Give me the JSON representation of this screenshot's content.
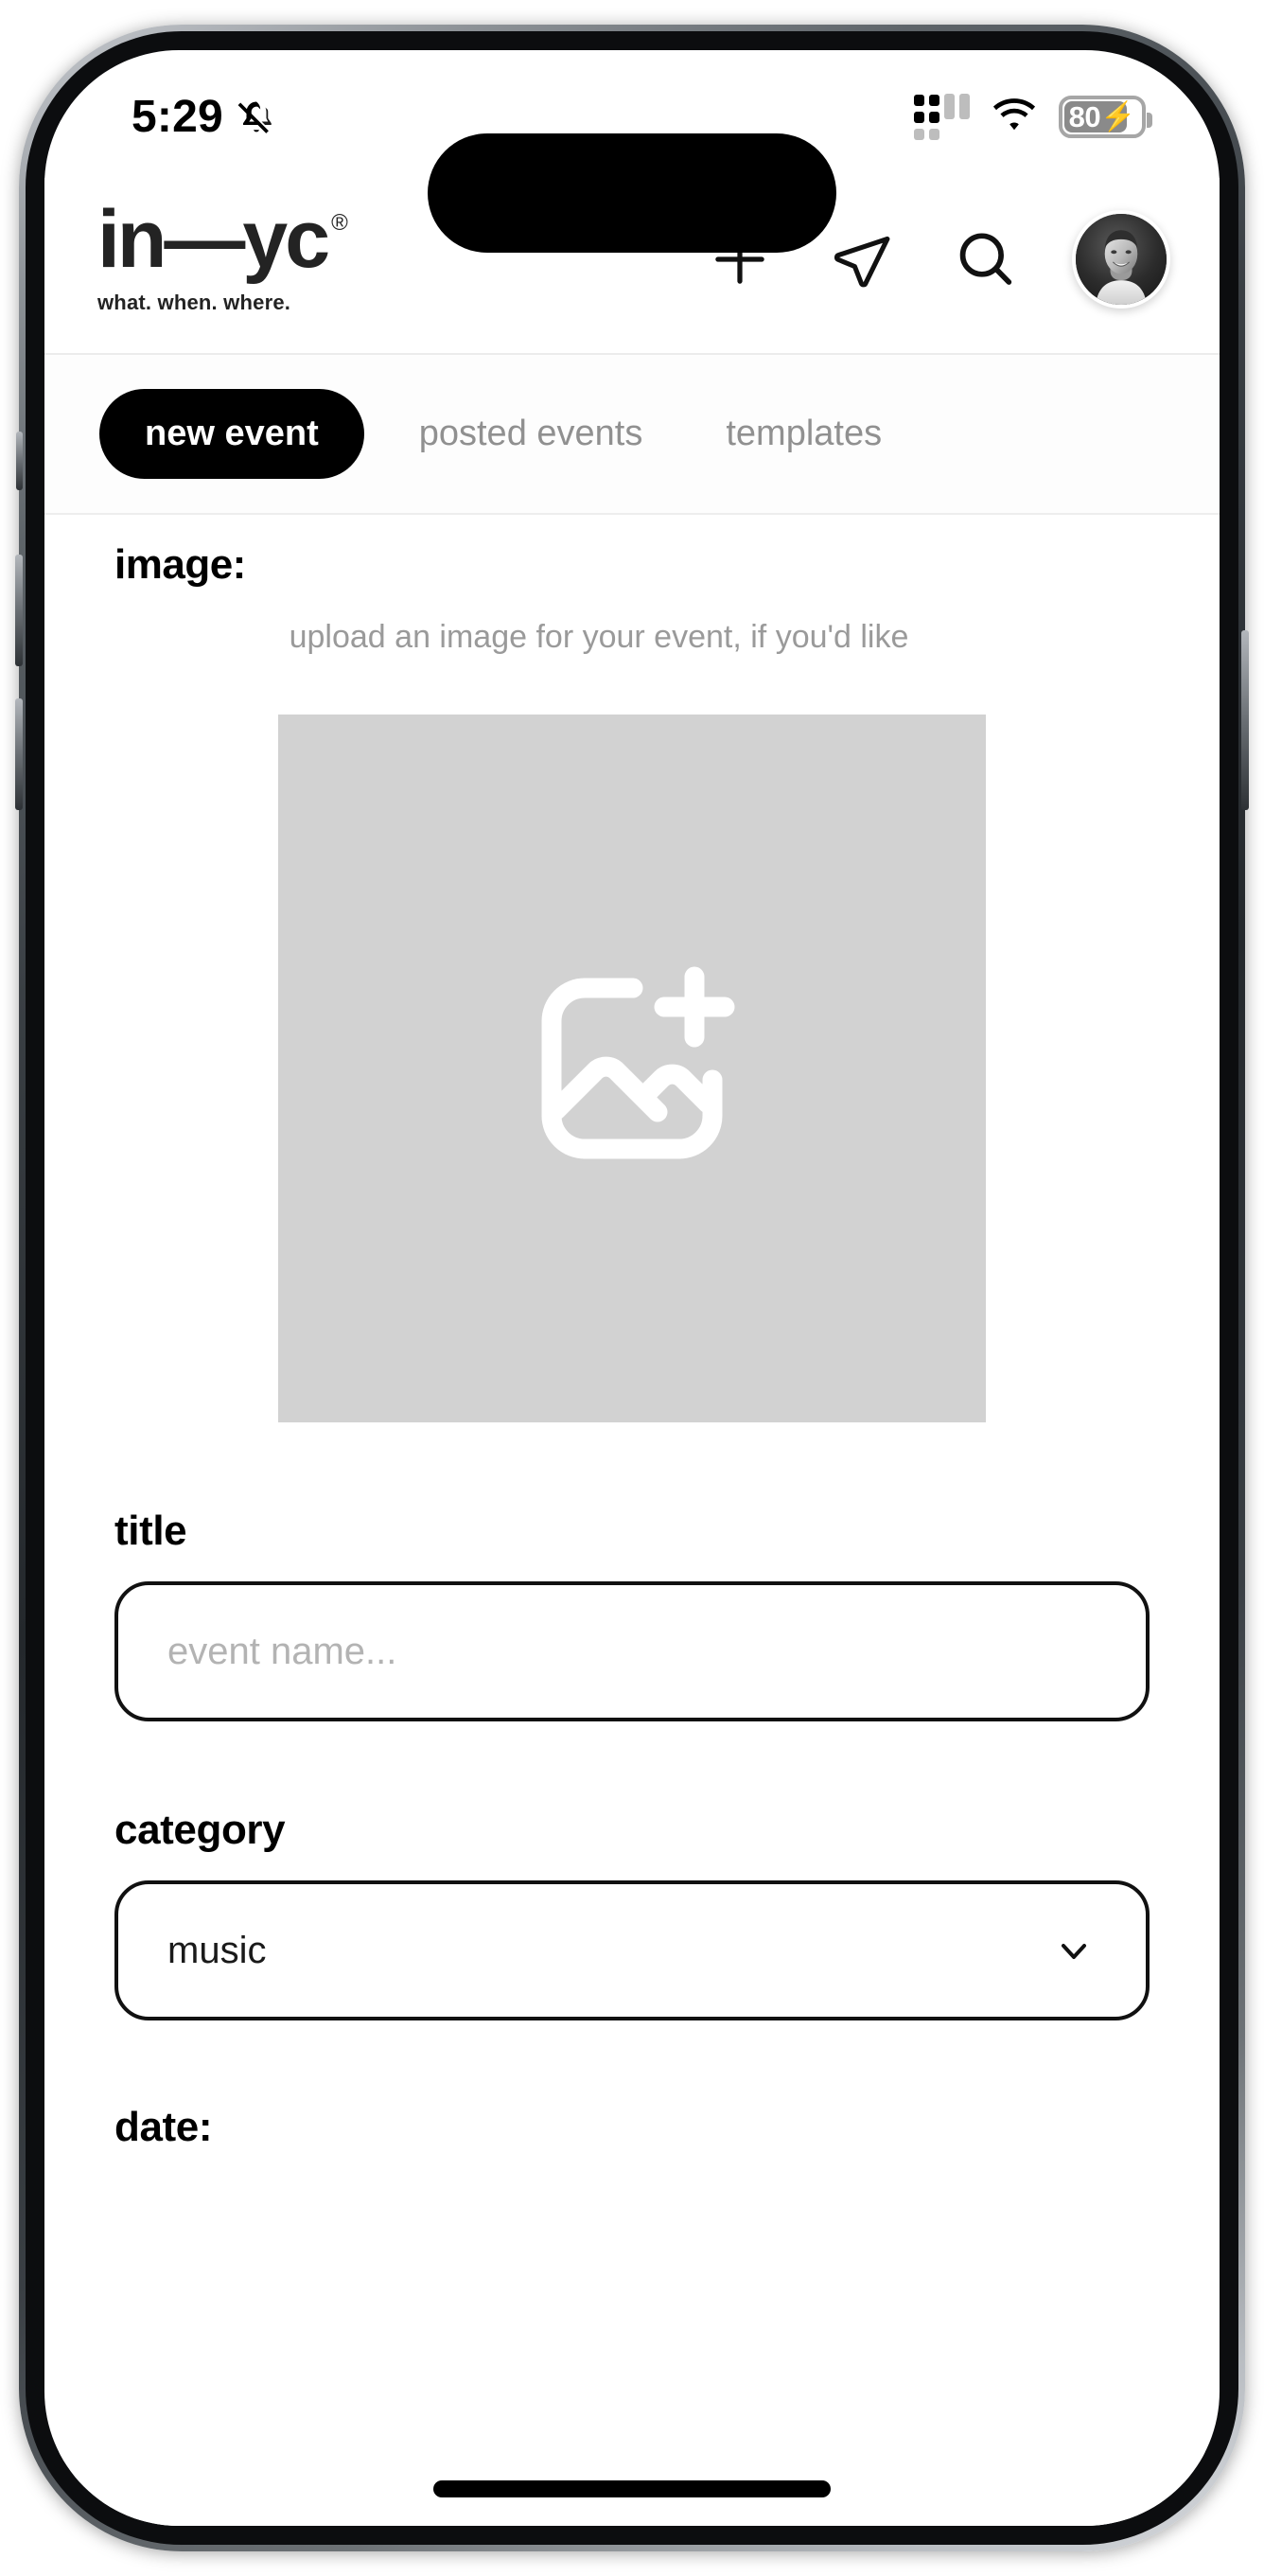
{
  "status_bar": {
    "time": "5:29",
    "bell_icon": "bell-muted-icon",
    "signal_icon": "cellular-signal-icon",
    "wifi_icon": "wifi-icon",
    "battery_level": "80",
    "battery_charging_icon": "charging-bolt-icon"
  },
  "header": {
    "logo_text": "in—yc",
    "logo_registered": "®",
    "tagline": "what. when. where.",
    "actions": [
      {
        "name": "add-icon",
        "glyph": "plus"
      },
      {
        "name": "send-icon",
        "glyph": "paper-plane"
      },
      {
        "name": "search-icon",
        "glyph": "magnifier"
      },
      {
        "name": "avatar",
        "glyph": "profile-photo"
      }
    ]
  },
  "tabs": [
    {
      "label": "new event",
      "active": true
    },
    {
      "label": "posted events",
      "active": false
    },
    {
      "label": "templates",
      "active": false
    }
  ],
  "form": {
    "image_section": {
      "title": "image:",
      "subtitle": "upload an image for your event, if you'd like",
      "dropzone_icon": "add-photo-icon",
      "dropzone_bg": "#d2d2d2"
    },
    "title_field": {
      "label": "title",
      "placeholder": "event name...",
      "value": ""
    },
    "category_field": {
      "label": "category",
      "value": "music",
      "chevron_icon": "chevron-down-icon"
    },
    "date_section": {
      "title": "date:"
    }
  },
  "colors": {
    "accent": "#000000",
    "muted_text": "#909090",
    "placeholder": "#b3b3b3",
    "border": "#111111"
  }
}
